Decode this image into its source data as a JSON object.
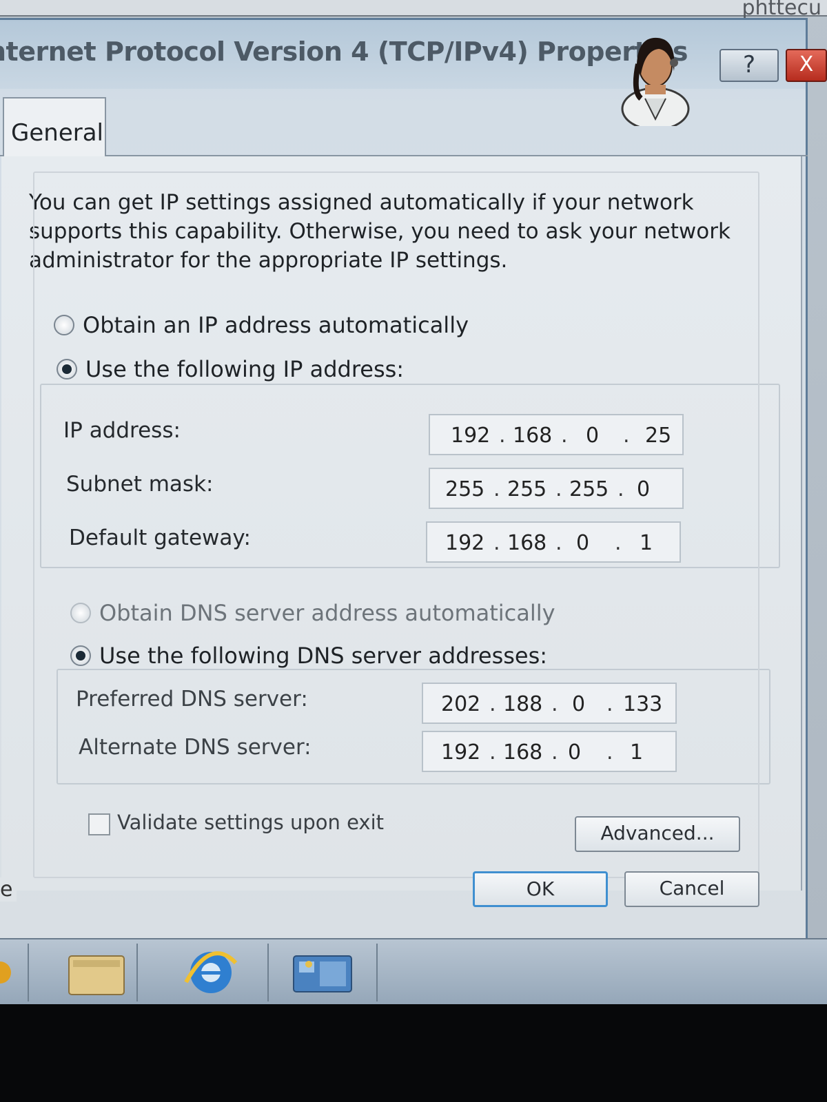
{
  "top_edge": {
    "text": "phttecu"
  },
  "window": {
    "title": "nternet Protocol Version 4 (TCP/IPv4) Properties",
    "help_label": "?",
    "close_label": "X"
  },
  "tabs": [
    {
      "label": "General",
      "selected": true
    }
  ],
  "intro_text": "You can get IP settings assigned automatically if your network supports this capability. Otherwise, you need to ask your network administrator for the appropriate IP settings.",
  "ip_mode": {
    "auto_label": "Obtain an IP address automatically",
    "auto_checked": false,
    "manual_label": "Use the following IP address:",
    "manual_checked": true
  },
  "ip_fields": {
    "ip_label": "IP address:",
    "ip_value": [
      "192",
      "168",
      "0",
      "25"
    ],
    "subnet_label": "Subnet mask:",
    "subnet_value": [
      "255",
      "255",
      "255",
      "0"
    ],
    "gateway_label": "Default gateway:",
    "gateway_value": [
      "192",
      "168",
      "0",
      "1"
    ]
  },
  "dns_mode": {
    "auto_label": "Obtain DNS server address automatically",
    "auto_checked": false,
    "manual_label": "Use the following DNS server addresses:",
    "manual_checked": true
  },
  "dns_fields": {
    "preferred_label": "Preferred DNS server:",
    "preferred_value": [
      "202",
      "188",
      "0",
      "133"
    ],
    "alternate_label": "Alternate DNS server:",
    "alternate_value": [
      "192",
      "168",
      "0",
      "1"
    ]
  },
  "validate": {
    "label": "Validate settings upon exit",
    "checked": false
  },
  "buttons": {
    "advanced": "Advanced...",
    "ok": "OK",
    "cancel": "Cancel"
  },
  "left_edge_text": "e"
}
